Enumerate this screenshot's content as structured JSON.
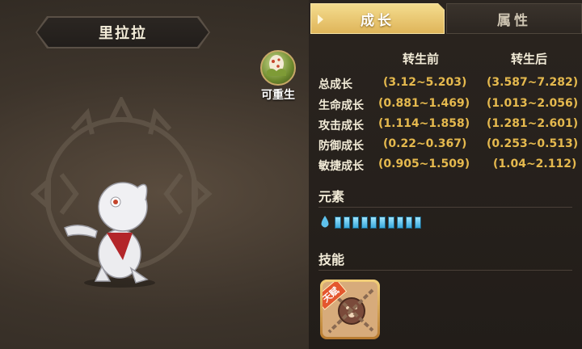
{
  "monster": {
    "name": "里拉拉",
    "reborn_label": "可重生"
  },
  "tabs": [
    {
      "label": "成长",
      "active": true
    },
    {
      "label": "属性",
      "active": false
    }
  ],
  "growth": {
    "columns": [
      "转生前",
      "转生后"
    ],
    "rows": [
      {
        "label": "总成长",
        "before": "(3.12~5.203)",
        "after": "(3.587~7.282)"
      },
      {
        "label": "生命成长",
        "before": "(0.881~1.469)",
        "after": "(1.013~2.056)"
      },
      {
        "label": "攻击成长",
        "before": "(1.114~1.858)",
        "after": "(1.281~2.601)"
      },
      {
        "label": "防御成长",
        "before": "(0.22~0.367)",
        "after": "(0.253~0.513)"
      },
      {
        "label": "敏捷成长",
        "before": "(0.905~1.509)",
        "after": "(1.04~2.112)"
      }
    ]
  },
  "element": {
    "title": "元素",
    "type": "water-drop-icon",
    "level": 10,
    "color": "#39a9dc"
  },
  "skills": {
    "title": "技能",
    "items": [
      {
        "badge": "天赋",
        "icon": "chained-face-icon"
      }
    ]
  },
  "colors": {
    "accent": "#dfb55a",
    "value": "#e5b94e",
    "panel": "#2a241f"
  }
}
